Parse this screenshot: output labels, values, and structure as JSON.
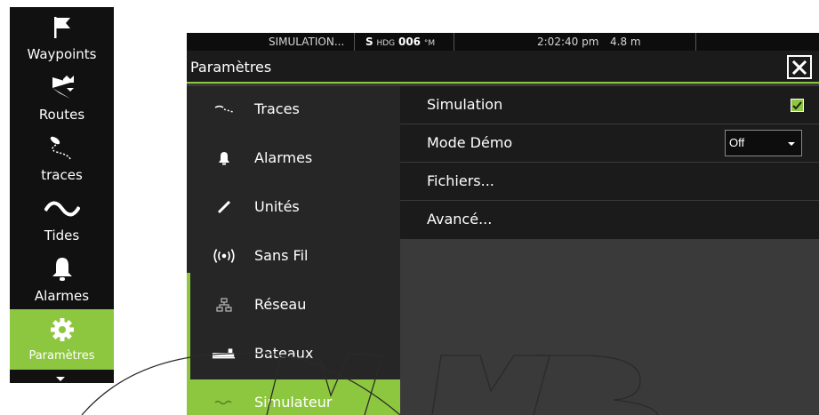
{
  "left_menu": {
    "items": [
      {
        "label": "Waypoints",
        "icon": "flag-icon",
        "selected": false
      },
      {
        "label": "Routes",
        "icon": "route-icon",
        "selected": false
      },
      {
        "label": "traces",
        "icon": "trail-icon",
        "selected": false
      },
      {
        "label": "Tides",
        "icon": "tide-wave-icon",
        "selected": false
      },
      {
        "label": "Alarmes",
        "icon": "bell-icon",
        "selected": false
      },
      {
        "label": "Paramètres",
        "icon": "gear-icon",
        "selected": true
      }
    ]
  },
  "status_bar": {
    "source": "SIMULATION...",
    "hdg_prefix": "S",
    "hdg_label": "HDG",
    "hdg_value": "006",
    "hdg_unit": "°M",
    "time": "2:02:40 pm",
    "depth": "4.8 m"
  },
  "window": {
    "title": "Paramètres",
    "close_icon": "close-icon"
  },
  "categories": [
    {
      "label": "Traces",
      "icon": "trail-icon",
      "selected": false
    },
    {
      "label": "Alarmes",
      "icon": "bell-icon",
      "selected": false
    },
    {
      "label": "Unités",
      "icon": "ruler-icon",
      "selected": false
    },
    {
      "label": "Sans Fil",
      "icon": "wireless-icon",
      "selected": false
    },
    {
      "label": "Réseau",
      "icon": "network-icon",
      "selected": false
    },
    {
      "label": "Bateaux",
      "icon": "vessel-icon",
      "selected": false
    },
    {
      "label": "Simulateur",
      "icon": "simulator-icon",
      "selected": true
    }
  ],
  "options": {
    "simulation": {
      "label": "Simulation",
      "checked": true
    },
    "demo_mode": {
      "label": "Mode Démo",
      "value": "Off"
    },
    "files": {
      "label": "Fichiers..."
    },
    "advanced": {
      "label": "Avancé..."
    }
  },
  "colors": {
    "accent": "#8dc63f",
    "menu_bg": "#111111",
    "panel_bg": "#1b1b1b",
    "list_bg": "#262626",
    "content_bg": "#3a3a3a"
  }
}
